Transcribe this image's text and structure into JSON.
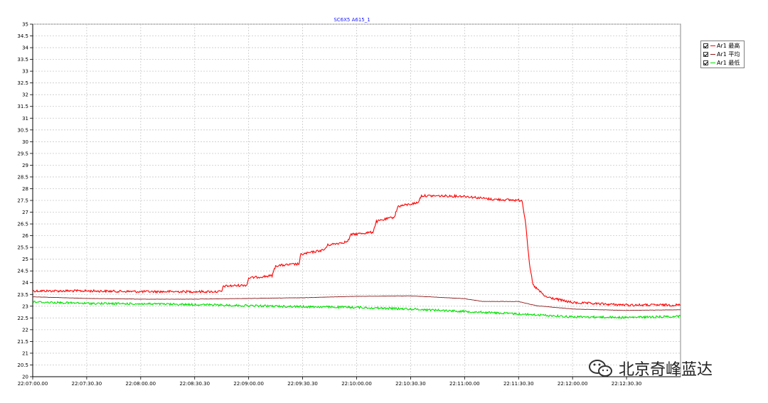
{
  "chart_data": {
    "type": "line",
    "title": "SC6X5 A615_1",
    "xlabel": "",
    "ylabel": "",
    "x_range": [
      "22:07:00.00",
      "22:13:00.00"
    ],
    "xticks": [
      "22:07:00.00",
      "22:07:30.30",
      "22:08:00.00",
      "22:08:30.30",
      "22:09:00.00",
      "22:09:30.30",
      "22:10:00.00",
      "22:10:30.30",
      "22:11:00.00",
      "22:11:30.30",
      "22:12:00.00",
      "22:12:30.30"
    ],
    "ylim": [
      20,
      35
    ],
    "yticks": [
      "20",
      "20.5",
      "21",
      "21.5",
      "22",
      "22.5",
      "23",
      "23.5",
      "24",
      "24.5",
      "25",
      "25.5",
      "26",
      "26.5",
      "27",
      "27.5",
      "28",
      "28.5",
      "29",
      "29.5",
      "30",
      "30.5",
      "31",
      "31.5",
      "32",
      "32.5",
      "33",
      "33.5",
      "34",
      "34.5",
      "35"
    ],
    "grid": true,
    "legend_position": "top-right",
    "series": [
      {
        "name": "Ar1 最高",
        "color": "#ff0000",
        "points": [
          [
            "22:07:00",
            23.65
          ],
          [
            "22:07:30",
            23.65
          ],
          [
            "22:08:00",
            23.62
          ],
          [
            "22:08:30",
            23.62
          ],
          [
            "22:08:45",
            23.62
          ],
          [
            "22:08:46",
            23.85
          ],
          [
            "22:08:59",
            23.9
          ],
          [
            "22:09:00",
            24.2
          ],
          [
            "22:09:13",
            24.3
          ],
          [
            "22:09:15",
            24.72
          ],
          [
            "22:09:28",
            24.8
          ],
          [
            "22:09:29",
            25.2
          ],
          [
            "22:09:42",
            25.4
          ],
          [
            "22:09:44",
            25.6
          ],
          [
            "22:09:55",
            25.75
          ],
          [
            "22:09:57",
            26.05
          ],
          [
            "22:10:09",
            26.15
          ],
          [
            "22:10:11",
            26.6
          ],
          [
            "22:10:21",
            26.8
          ],
          [
            "22:10:23",
            27.25
          ],
          [
            "22:10:34",
            27.4
          ],
          [
            "22:10:36",
            27.7
          ],
          [
            "22:11:00",
            27.68
          ],
          [
            "22:11:15",
            27.55
          ],
          [
            "22:11:32",
            27.5
          ],
          [
            "22:11:34",
            26.5
          ],
          [
            "22:11:36",
            24.8
          ],
          [
            "22:11:38",
            23.9
          ],
          [
            "22:11:45",
            23.4
          ],
          [
            "22:12:00",
            23.15
          ],
          [
            "22:12:30",
            23.05
          ],
          [
            "22:13:00",
            23.05
          ]
        ]
      },
      {
        "name": "Ar1 平均",
        "color": "#8b1a1a",
        "points": [
          [
            "22:07:00",
            23.4
          ],
          [
            "22:07:30",
            23.33
          ],
          [
            "22:08:00",
            23.3
          ],
          [
            "22:08:30",
            23.3
          ],
          [
            "22:09:00",
            23.33
          ],
          [
            "22:09:30",
            23.36
          ],
          [
            "22:10:00",
            23.42
          ],
          [
            "22:10:30",
            23.44
          ],
          [
            "22:11:00",
            23.32
          ],
          [
            "22:11:10",
            23.2
          ],
          [
            "22:11:30",
            23.2
          ],
          [
            "22:11:40",
            23.02
          ],
          [
            "22:12:00",
            22.88
          ],
          [
            "22:12:30",
            22.82
          ],
          [
            "22:13:00",
            22.85
          ]
        ]
      },
      {
        "name": "Ar1 最低",
        "color": "#00e000",
        "points": [
          [
            "22:07:00",
            23.18
          ],
          [
            "22:07:30",
            23.12
          ],
          [
            "22:08:00",
            23.1
          ],
          [
            "22:08:30",
            23.07
          ],
          [
            "22:09:00",
            23.02
          ],
          [
            "22:09:30",
            22.98
          ],
          [
            "22:10:00",
            22.95
          ],
          [
            "22:10:30",
            22.88
          ],
          [
            "22:11:00",
            22.78
          ],
          [
            "22:11:30",
            22.67
          ],
          [
            "22:12:00",
            22.55
          ],
          [
            "22:12:30",
            22.52
          ],
          [
            "22:13:00",
            22.57
          ]
        ]
      }
    ]
  },
  "legend": {
    "items": [
      {
        "label": "Ar1 最高",
        "color": "#ff0000"
      },
      {
        "label": "Ar1 平均",
        "color": "#8b1a1a"
      },
      {
        "label": "Ar1 最低",
        "color": "#00e000"
      }
    ]
  },
  "watermark": {
    "text": "北京奇峰蓝达",
    "icon": "wechat-icon"
  }
}
